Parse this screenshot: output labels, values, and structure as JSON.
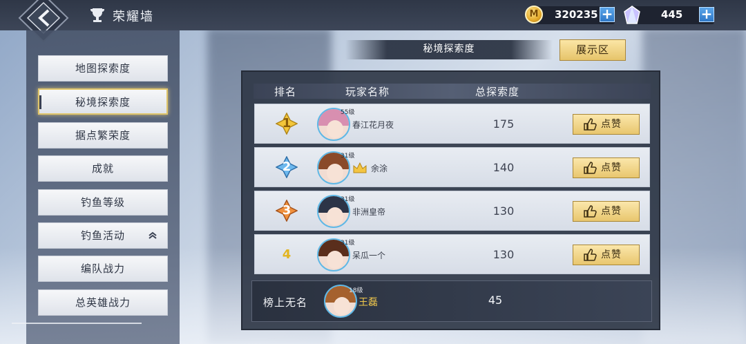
{
  "header": {
    "title": "荣耀墙",
    "coins": "320235",
    "coin_glyph": "M",
    "gems": "445",
    "plus": "+"
  },
  "sidebar": {
    "items": [
      {
        "label": "地图探索度",
        "active": false
      },
      {
        "label": "秘境探索度",
        "active": true
      },
      {
        "label": "据点繁荣度",
        "active": false
      },
      {
        "label": "成就",
        "active": false
      },
      {
        "label": "钓鱼等级",
        "active": false
      },
      {
        "label": "钓鱼活动",
        "active": false,
        "collapsible": true
      },
      {
        "label": "编队战力",
        "active": false
      },
      {
        "label": "总英雄战力",
        "active": false
      }
    ]
  },
  "section": {
    "title": "秘境探索度",
    "showcase_label": "展示区"
  },
  "table": {
    "columns": [
      "排名",
      "玩家名称",
      "总探索度"
    ],
    "like_label": "点赞",
    "rows": [
      {
        "rank": "1",
        "level": "55级",
        "name": "春江花月夜",
        "score": "175"
      },
      {
        "rank": "2",
        "level": "31级",
        "name": "余涂",
        "score": "140"
      },
      {
        "rank": "3",
        "level": "31级",
        "name": "非洲皇帝",
        "score": "130"
      },
      {
        "rank": "4",
        "level": "31级",
        "name": "呆瓜一个",
        "score": "130"
      }
    ],
    "self": {
      "label": "榜上无名",
      "level": "18级",
      "name": "王磊",
      "score": "45"
    }
  },
  "colors": {
    "gold": "#e2b420",
    "silver_blue": "#4a9ad8",
    "bronze": "#e07a2e",
    "self_name": "#f2c94c"
  }
}
